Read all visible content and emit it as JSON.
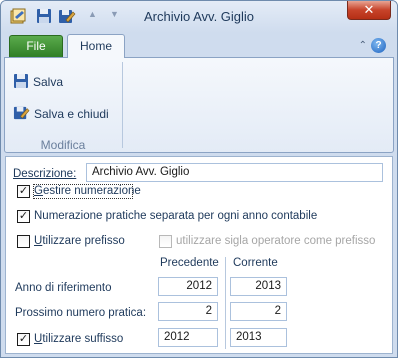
{
  "window": {
    "title": "Archivio Avv. Giglio",
    "close_glyph": "✕"
  },
  "ribbon": {
    "tabs": {
      "file": "File",
      "home": "Home"
    },
    "buttons": {
      "save": "Salva",
      "save_close": "Salva e chiudi"
    },
    "group_label": "Modifica",
    "minimize_glyph": "⌃",
    "help_glyph": "?"
  },
  "form": {
    "description_label": "Descrizione:",
    "description_value": "Archivio Avv. Giglio",
    "gestire_label": "Gestire numerazione",
    "gestire_checked": true,
    "separate_label": "Numerazione pratiche separata per ogni anno contabile",
    "separate_checked": true,
    "prefix_label": "Utilizzare prefisso",
    "prefix_checked": false,
    "sigla_label": "utilizzare sigla operatore come prefisso",
    "sigla_checked": false,
    "col_prev": "Precedente",
    "col_curr": "Corrente",
    "year_label": "Anno di riferimento",
    "year_prev": "2012",
    "year_curr": "2013",
    "next_label": "Prossimo numero pratica:",
    "next_prev": "2",
    "next_curr": "2",
    "suffix_label": "Utilizzare suffisso",
    "suffix_checked": true,
    "suffix_prev": "2012",
    "suffix_curr": "2013"
  },
  "icons": [
    "app-icon",
    "save-icon",
    "save-close-icon",
    "undo-arrow-icon",
    "redo-arrow-icon",
    "help-icon"
  ]
}
